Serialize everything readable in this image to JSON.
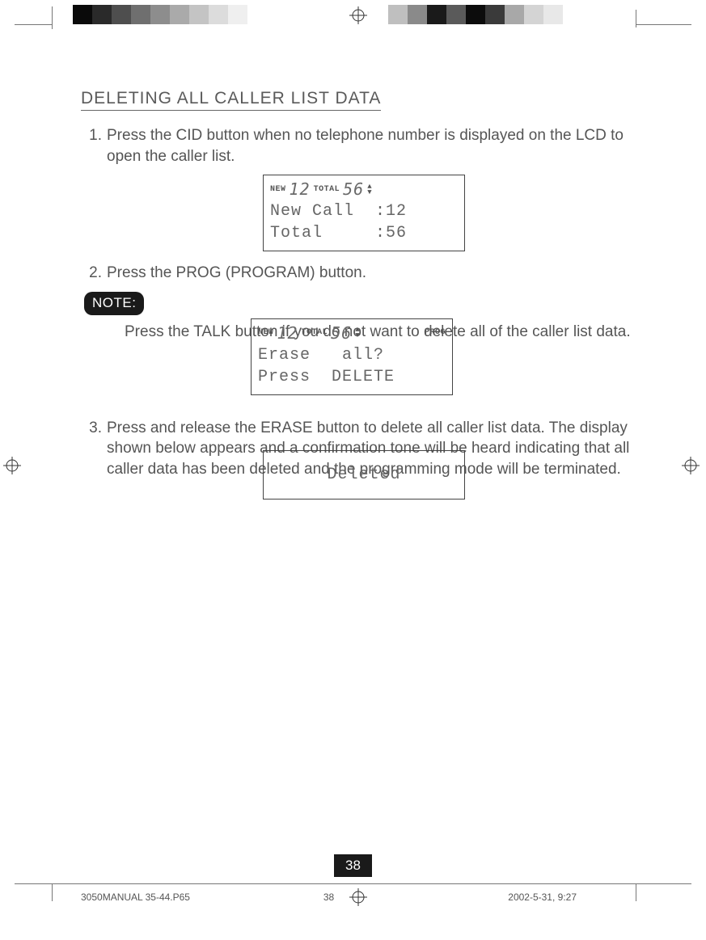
{
  "heading": "DELETING ALL CALLER LIST DATA",
  "steps": {
    "s1": {
      "num": "1.",
      "text": "Press the CID button when no telephone number is displayed on the LCD to open the caller list."
    },
    "s2": {
      "num": "2.",
      "text": "Press the PROG (PROGRAM) button."
    },
    "s3": {
      "num": "3.",
      "text": "Press and release the ERASE button to delete all caller list data. The display shown below appears and a confirmation tone will be heard indicating that all caller data has been deleted and the programming mode will be terminated."
    }
  },
  "note": {
    "label": "NOTE:",
    "text": "Press the TALK button if you do not want to delete all of the caller list data."
  },
  "lcd1": {
    "status_new": "NEW",
    "status_new_val": "12",
    "status_total": "TOTAL",
    "status_total_val": "56",
    "line1": "New Call  :12",
    "line2": "Total     :56"
  },
  "lcd2": {
    "status_new": "NEW",
    "status_new_val": "12",
    "status_total": "TOTAL",
    "status_total_val": "56",
    "status_prog": "PROG",
    "line1": "Erase   all?",
    "line2": "Press  DELETE"
  },
  "lcd3": {
    "text": "Deleted"
  },
  "page_number": "38",
  "footer": {
    "file": "3050MANUAL 35-44.P65",
    "page": "38",
    "date": "2002-5-31, 9:27"
  },
  "swatches_left": [
    "#0a0a0a",
    "#2a2a2a",
    "#4e4e4e",
    "#6f6f6f",
    "#8d8d8d",
    "#aaaaaa",
    "#c4c4c4",
    "#dcdcdc",
    "#efefef",
    "#ffffff"
  ],
  "swatches_right": [
    "#bfbfbf",
    "#8a8a8a",
    "#1a1a1a",
    "#5a5a5a",
    "#0c0c0c",
    "#3a3a3a",
    "#a8a8a8",
    "#d4d4d4",
    "#e8e8e8"
  ]
}
